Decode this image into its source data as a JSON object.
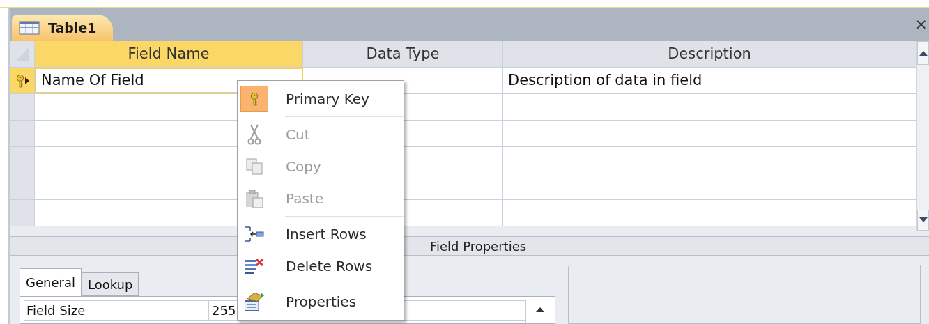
{
  "tab": {
    "title": "Table1",
    "close": "×"
  },
  "table": {
    "columns": [
      "Field Name",
      "Data Type",
      "Description"
    ],
    "rows": [
      {
        "field_name": "Name Of Field",
        "description": "Description of data in field",
        "primary_key": true,
        "selected": true
      },
      {
        "primary_key": false,
        "selected": false
      },
      {
        "primary_key": false,
        "selected": false
      },
      {
        "primary_key": false,
        "selected": false
      },
      {
        "primary_key": false,
        "selected": false
      },
      {
        "primary_key": false,
        "selected": false
      }
    ]
  },
  "field_properties": {
    "title": "Field Properties",
    "tabs": [
      {
        "label": "General",
        "selected": true
      },
      {
        "label": "Lookup",
        "selected": false
      }
    ],
    "rows": [
      {
        "name": "Field Size",
        "value": "255"
      }
    ]
  },
  "context_menu": {
    "items": [
      {
        "kind": "item",
        "label": "Primary Key",
        "disabled": false,
        "highlighted": true
      },
      {
        "kind": "separator"
      },
      {
        "kind": "item",
        "label": "Cut",
        "disabled": true,
        "highlighted": false
      },
      {
        "kind": "item",
        "label": "Copy",
        "disabled": true,
        "highlighted": false
      },
      {
        "kind": "item",
        "label": "Paste",
        "disabled": true,
        "highlighted": false
      },
      {
        "kind": "separator"
      },
      {
        "kind": "item",
        "label": "Insert Rows",
        "disabled": false,
        "highlighted": false
      },
      {
        "kind": "item",
        "label": "Delete Rows",
        "disabled": false,
        "highlighted": false
      },
      {
        "kind": "separator"
      },
      {
        "kind": "item",
        "label": "Properties",
        "disabled": false,
        "highlighted": false
      }
    ]
  }
}
